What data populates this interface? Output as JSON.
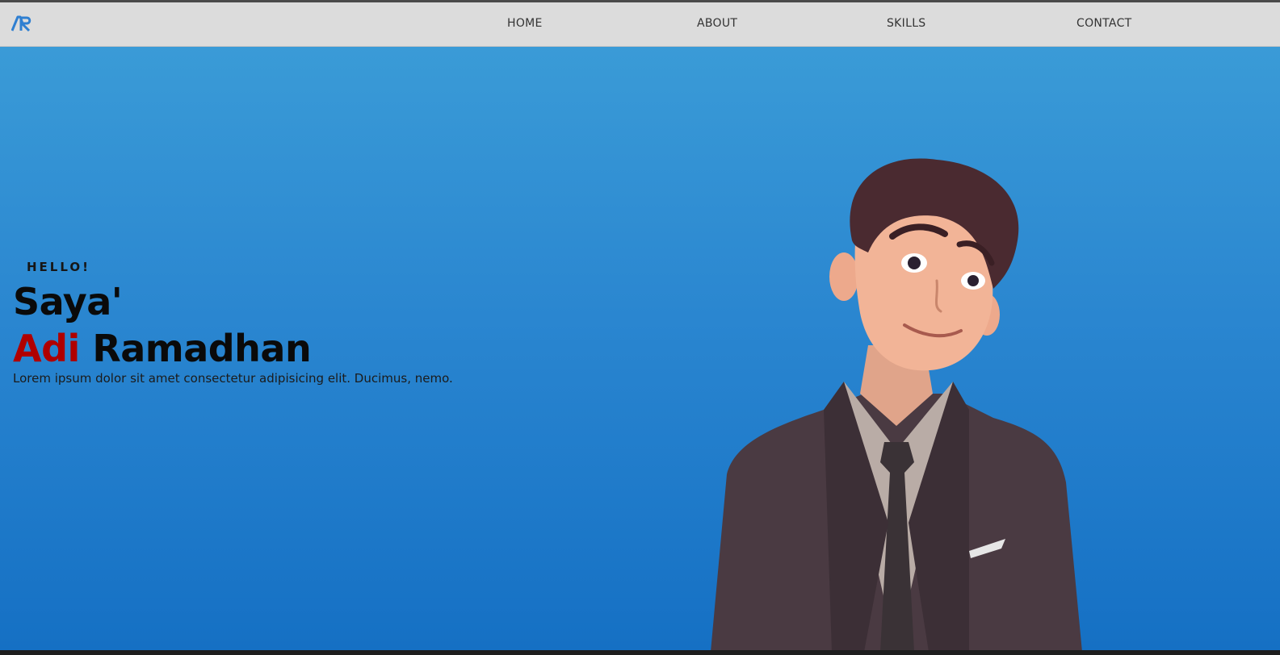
{
  "brand": {
    "logo_text": "AR",
    "logo_color": "#2f7fd1"
  },
  "nav": {
    "items": [
      {
        "label": "HOME"
      },
      {
        "label": "ABOUT"
      },
      {
        "label": "SKILLS"
      },
      {
        "label": "CONTACT"
      }
    ]
  },
  "hero": {
    "greeting": "HELLO!",
    "intro_line": "Saya'",
    "first_name": "Adi",
    "last_name": "Ramadhan",
    "description": "Lorem ipsum dolor sit amet consectetur adipisicing elit. Ducimus, nemo.",
    "first_name_color": "#b00000",
    "background_colors": [
      "#3a9bd7",
      "#1570c4"
    ]
  },
  "avatar": {
    "description_icon": "cartoon-avatar-man-in-suit"
  }
}
